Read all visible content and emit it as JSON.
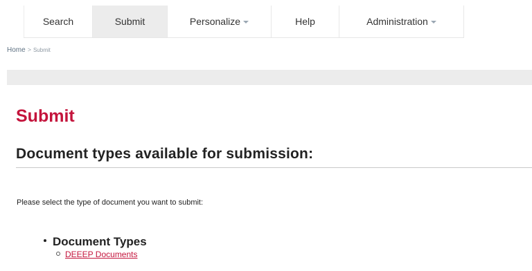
{
  "nav": {
    "tabs": [
      {
        "label": "Search",
        "active": false,
        "has_dropdown": false
      },
      {
        "label": "Submit",
        "active": true,
        "has_dropdown": false
      },
      {
        "label": "Personalize",
        "active": false,
        "has_dropdown": true
      },
      {
        "label": "Help",
        "active": false,
        "has_dropdown": false
      },
      {
        "label": "Administration",
        "active": false,
        "has_dropdown": true
      }
    ],
    "dropdown_icon": "chevron-down-icon"
  },
  "breadcrumb": {
    "home": "Home",
    "separator": ">",
    "current": "Submit"
  },
  "page": {
    "title": "Submit",
    "section_title": "Document types available for submission:",
    "instructions": "Please select the type of document you want to submit:"
  },
  "document_types": {
    "heading": "Document Types",
    "items": [
      {
        "label": "DEEEP Documents"
      }
    ]
  },
  "colors": {
    "accent": "#c4143c",
    "active_tab_bg": "#ececec",
    "gray_bar": "#ececec"
  }
}
